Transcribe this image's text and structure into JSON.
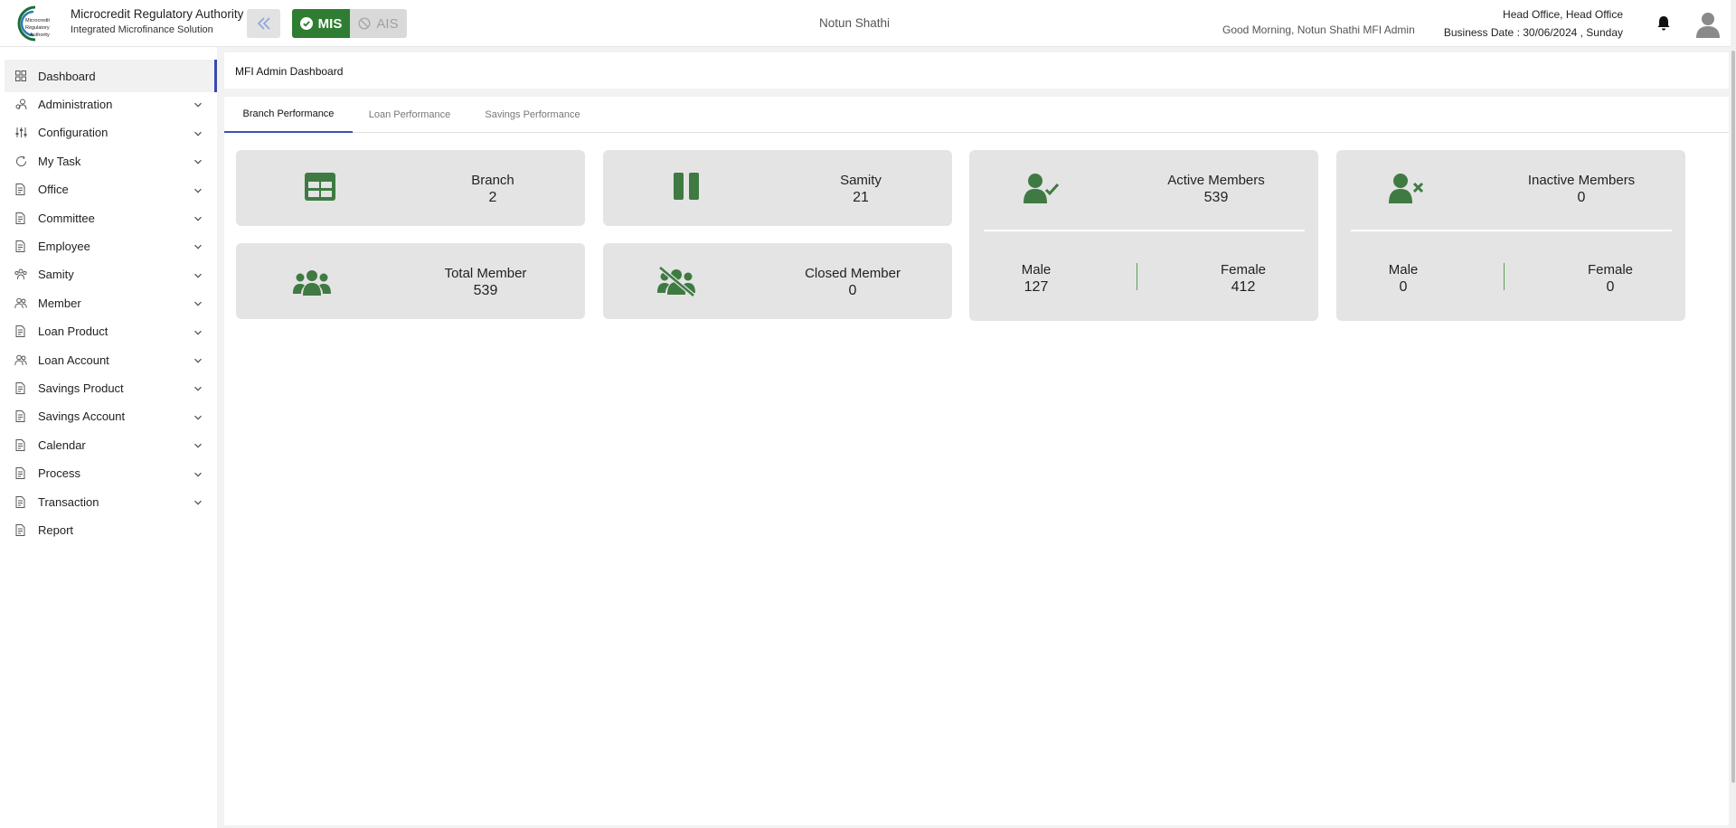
{
  "header": {
    "org_name": "Microcredit Regulatory Authority",
    "org_subtitle": "Integrated Microfinance Solution",
    "logo_text": [
      "Microcredit",
      "Regulatory",
      "Authority"
    ],
    "mis_label": "MIS",
    "ais_label": "AIS",
    "center_title": "Notun Shathi",
    "greeting": "Good Morning, Notun Shathi MFI Admin",
    "office": "Head Office, Head Office",
    "business_date": "Business Date : 30/06/2024 , Sunday",
    "accent_color": "#2e7d32"
  },
  "sidebar": {
    "items": [
      {
        "label": "Dashboard",
        "icon": "grid-icon",
        "expandable": false,
        "active": true
      },
      {
        "label": "Administration",
        "icon": "admin-icon",
        "expandable": true
      },
      {
        "label": "Configuration",
        "icon": "sliders-icon",
        "expandable": true
      },
      {
        "label": "My Task",
        "icon": "task-icon",
        "expandable": true
      },
      {
        "label": "Office",
        "icon": "doc-icon",
        "expandable": true
      },
      {
        "label": "Committee",
        "icon": "doc-icon",
        "expandable": true
      },
      {
        "label": "Employee",
        "icon": "doc-icon",
        "expandable": true
      },
      {
        "label": "Samity",
        "icon": "group-icon",
        "expandable": true
      },
      {
        "label": "Member",
        "icon": "people-icon",
        "expandable": true
      },
      {
        "label": "Loan Product",
        "icon": "doc-icon",
        "expandable": true
      },
      {
        "label": "Loan Account",
        "icon": "people-icon",
        "expandable": true
      },
      {
        "label": "Savings Product",
        "icon": "doc-icon",
        "expandable": true
      },
      {
        "label": "Savings Account",
        "icon": "doc-icon",
        "expandable": true
      },
      {
        "label": "Calendar",
        "icon": "doc-icon",
        "expandable": true
      },
      {
        "label": "Process",
        "icon": "doc-icon",
        "expandable": true
      },
      {
        "label": "Transaction",
        "icon": "doc-icon",
        "expandable": true
      },
      {
        "label": "Report",
        "icon": "doc-icon",
        "expandable": false
      }
    ]
  },
  "page": {
    "title": "MFI Admin Dashboard"
  },
  "tabs": [
    "Branch Performance",
    "Loan Performance",
    "Savings Performance"
  ],
  "cards": {
    "branch": {
      "label": "Branch",
      "value": "2"
    },
    "samity": {
      "label": "Samity",
      "value": "21"
    },
    "total_member": {
      "label": "Total Member",
      "value": "539"
    },
    "closed_member": {
      "label": "Closed Member",
      "value": "0"
    },
    "active_members": {
      "label": "Active Members",
      "value": "539",
      "male_label": "Male",
      "male_value": "127",
      "female_label": "Female",
      "female_value": "412"
    },
    "inactive_members": {
      "label": "Inactive Members",
      "value": "0",
      "male_label": "Male",
      "male_value": "0",
      "female_label": "Female",
      "female_value": "0"
    }
  }
}
